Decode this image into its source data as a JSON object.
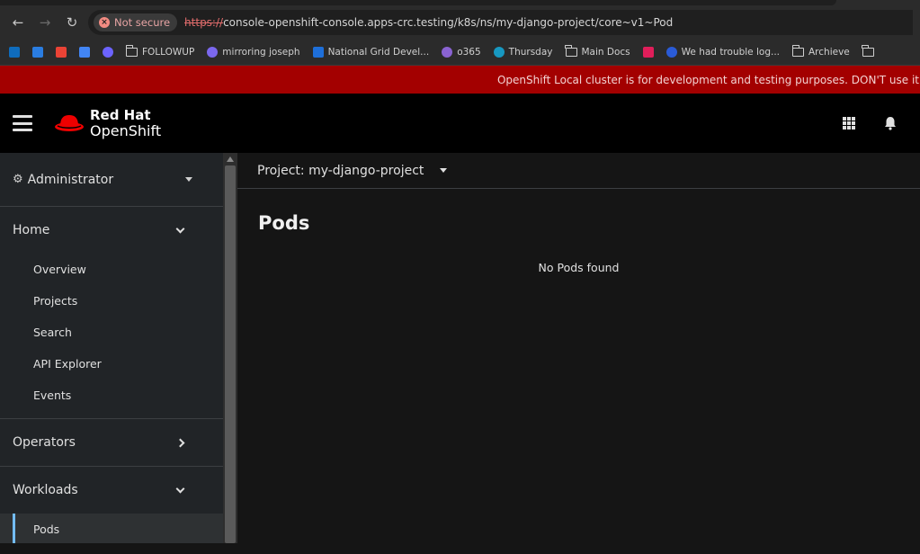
{
  "browser": {
    "security_label": "Not secure",
    "url_scheme": "https://",
    "url_rest": "console-openshift-console.apps-crc.testing/k8s/ns/my-django-project/core~v1~Pod",
    "bookmarks": [
      {
        "label": "FOLLOWUP",
        "type": "folder"
      },
      {
        "label": "mirroring joseph",
        "type": "link"
      },
      {
        "label": "National Grid Devel...",
        "type": "link"
      },
      {
        "label": "o365",
        "type": "link"
      },
      {
        "label": "Thursday",
        "type": "link"
      },
      {
        "label": "Main Docs",
        "type": "folder"
      },
      {
        "label": "We had trouble log...",
        "type": "link"
      },
      {
        "label": "Archieve",
        "type": "folder"
      }
    ]
  },
  "banner": {
    "text": "OpenShift Local cluster is for development and testing purposes. DON'T use it"
  },
  "masthead": {
    "brand": "Red Hat",
    "product": "OpenShift"
  },
  "sidebar": {
    "perspective": "Administrator",
    "sections": [
      {
        "label": "Home",
        "expanded": true,
        "items": [
          "Overview",
          "Projects",
          "Search",
          "API Explorer",
          "Events"
        ]
      },
      {
        "label": "Operators",
        "expanded": false,
        "items": []
      },
      {
        "label": "Workloads",
        "expanded": true,
        "items": [
          "Pods"
        ]
      }
    ]
  },
  "main": {
    "project_label": "Project: my-django-project",
    "page_title": "Pods",
    "empty_message": "No Pods found"
  },
  "colors": {
    "banner_bg": "#a30000",
    "masthead_bg": "#000000",
    "sidebar_bg": "#212427",
    "active_indicator": "#73bcf7",
    "redhat_red": "#ee0000"
  }
}
